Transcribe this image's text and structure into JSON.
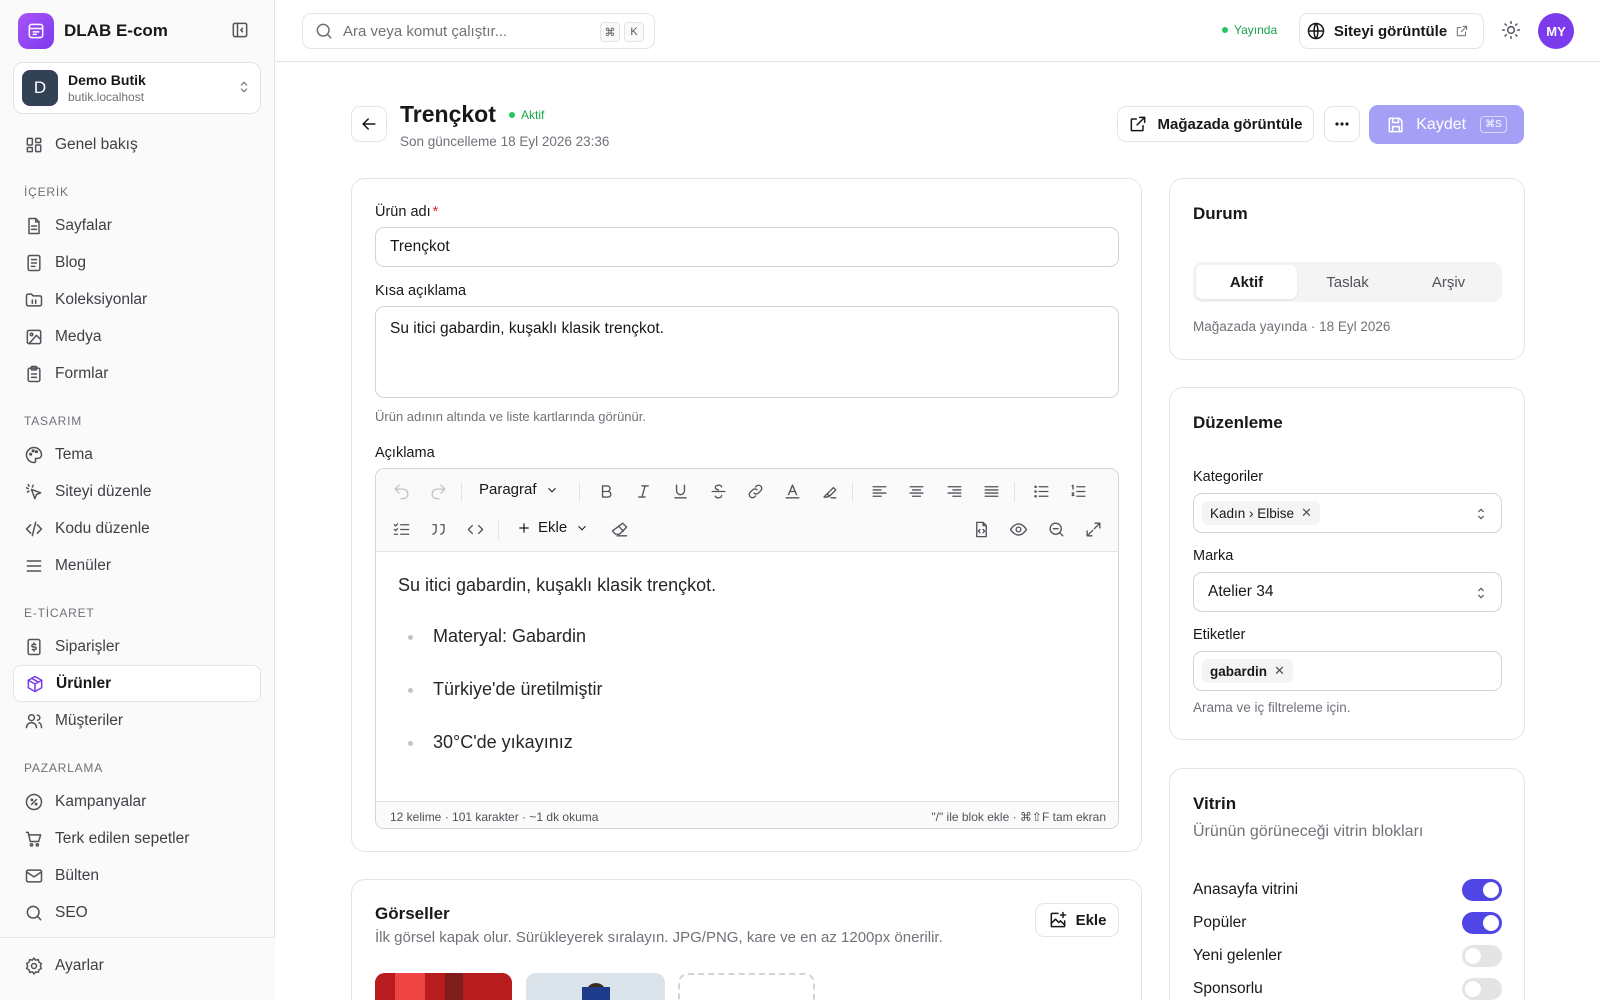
{
  "brand": {
    "name": "DLAB E-com"
  },
  "store": {
    "initial": "D",
    "name": "Demo Butik",
    "host": "butik.localhost"
  },
  "sidebar": {
    "overview": "Genel bakış",
    "sections": {
      "content": "İÇERİK",
      "design": "TASARIM",
      "commerce": "E-TİCARET",
      "marketing": "PAZARLAMA"
    },
    "content_items": [
      "Sayfalar",
      "Blog",
      "Koleksiyonlar",
      "Medya",
      "Formlar"
    ],
    "design_items": [
      "Tema",
      "Siteyi düzenle",
      "Kodu düzenle",
      "Menüler"
    ],
    "commerce_items": [
      "Siparişler",
      "Ürünler",
      "Müşteriler"
    ],
    "marketing_items": [
      "Kampanyalar",
      "Terk edilen sepetler",
      "Bülten",
      "SEO"
    ],
    "settings": "Ayarlar"
  },
  "topbar": {
    "search_placeholder": "Ara veya komut çalıştır...",
    "kbd1": "⌘",
    "kbd2": "K",
    "status": "Yayında",
    "view_site": "Siteyi görüntüle",
    "avatar": "MY"
  },
  "header": {
    "title": "Trençkot",
    "badge": "Aktif",
    "updated": "Son güncelleme 18 Eyl 2026 23:36",
    "store_view": "Mağazada görüntüle",
    "save": "Kaydet",
    "save_kbd": "⌘S"
  },
  "form": {
    "name_label": "Ürün adı",
    "name_required": "*",
    "name_value": "Trençkot",
    "short_label": "Kısa açıklama",
    "short_value": "Su itici gabardin, kuşaklı klasik trençkot.",
    "short_hint": "Ürün adının altında ve liste kartlarında görünür.",
    "desc_label": "Açıklama"
  },
  "editor": {
    "block_type": "Paragraf",
    "insert": "Ekle",
    "paragraph": "Su itici gabardin, kuşaklı klasik trençkot.",
    "bullets": [
      "Materyal: Gabardin",
      "Türkiye'de üretilmiştir",
      "30°C'de yıkayınız"
    ],
    "stats": "12 kelime · 101 karakter · ~1 dk okuma",
    "shortcut_hint": "\"/\" ile blok ekle · ⌘⇧F tam ekran"
  },
  "images": {
    "title": "Görseller",
    "hint": "İlk görsel kapak olur. Sürükleyerek sıralayın. JPG/PNG, kare ve en az 1200px önerilir.",
    "add": "Ekle"
  },
  "status_card": {
    "title": "Durum",
    "options": [
      "Aktif",
      "Taslak",
      "Arşiv"
    ],
    "selected": "Aktif",
    "note": "Mağazada yayında · 18 Eyl 2026"
  },
  "organize": {
    "title": "Düzenleme",
    "categories_label": "Kategoriler",
    "category_chip": "Kadın › Elbise",
    "brand_label": "Marka",
    "brand_value": "Atelier 34",
    "tags_label": "Etiketler",
    "tag_chip": "gabardin",
    "tags_hint": "Arama ve iç filtreleme için."
  },
  "showcase": {
    "title": "Vitrin",
    "subtitle": "Ürünün görüneceği vitrin blokları",
    "toggles": [
      {
        "label": "Anasayfa vitrini",
        "on": true
      },
      {
        "label": "Popüler",
        "on": true
      },
      {
        "label": "Yeni gelenler",
        "on": false
      },
      {
        "label": "Sponsorlu",
        "on": false
      }
    ]
  },
  "colors": {
    "accent": "#4f46e5",
    "brand": "#7c3aed",
    "success": "#16a34a",
    "save_disabled": "#a5a0f6"
  }
}
